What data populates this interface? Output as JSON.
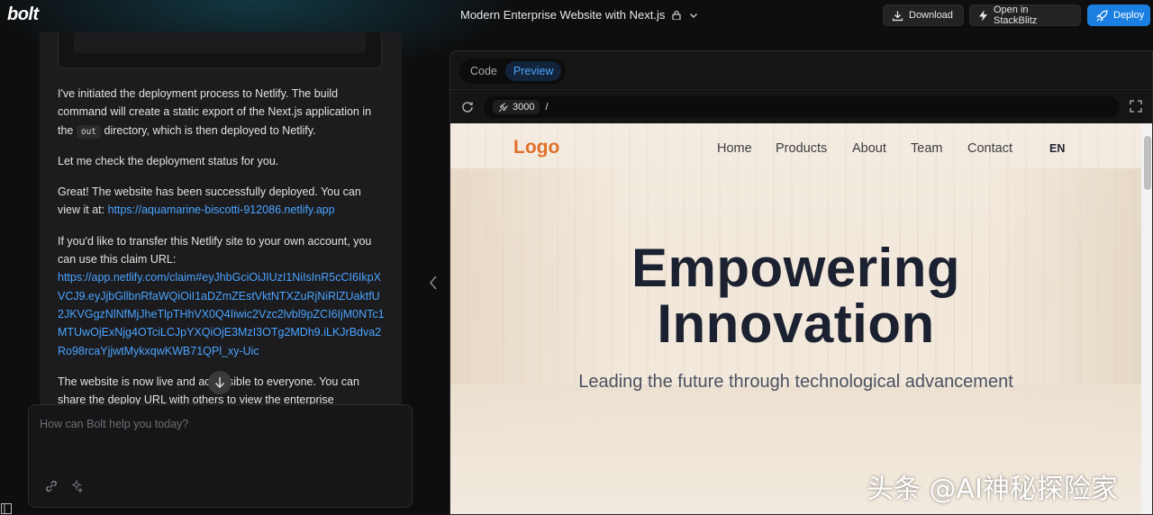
{
  "header": {
    "brand": "bolt",
    "project_title": "Modern Enterprise Website with Next.js",
    "download_label": "Download",
    "stackblitz_label": "Open in StackBlitz",
    "deploy_label": "Deploy"
  },
  "chat": {
    "p1_a": "I've initiated the deployment process to Netlify. The build command will create a static export of the Next.js application in the ",
    "p1_code": "out",
    "p1_b": " directory, which is then deployed to Netlify.",
    "p2": "Let me check the deployment status for you.",
    "p3_a": "Great! The website has been successfully deployed. You can view it at: ",
    "p3_link": "https://aquamarine-biscotti-912086.netlify.app",
    "p4_a": "If you'd like to transfer this Netlify site to your own account, you can use this claim URL:",
    "p4_link": "https://app.netlify.com/claim#eyJhbGciOiJIUzI1NiIsInR5cCI6IkpXVCJ9.eyJjbGllbnRfaWQiOiI1aDZmZEstVktNTXZuRjNiRlZUaktfU2JKVGgzNlNfMjJheTlpTHhVX0Q4Iiwic2Vzc2lvbl9pZCI6IjM0NTc1MTUwOjExNjg4OTciLCJpYXQiOjE3MzI3OTg2MDh9.iLKJrBdva2Ro98rcaYjjwtMykxqwKWB71QPl_xy-Uic",
    "p5": "The website is now live and accessible to everyone. You can share the deploy URL with others to view the enterprise"
  },
  "prompt": {
    "placeholder": "How can Bolt help you today?"
  },
  "workbench": {
    "tabs": [
      "Code",
      "Preview"
    ],
    "active_tab": "Preview",
    "port": "3000",
    "path": "/"
  },
  "site": {
    "logo": "Logo",
    "menu": [
      "Home",
      "Products",
      "About",
      "Team",
      "Contact"
    ],
    "lang": "EN",
    "hero_line1": "Empowering",
    "hero_line2": "Innovation",
    "hero_sub": "Leading the future through technological advancement"
  },
  "watermark": "头条 @AI神秘探险家",
  "colors": {
    "accent": "#1a7fe0",
    "link": "#4aa3ff",
    "site_logo": "#e0702a",
    "hero_text": "#1b2130"
  }
}
